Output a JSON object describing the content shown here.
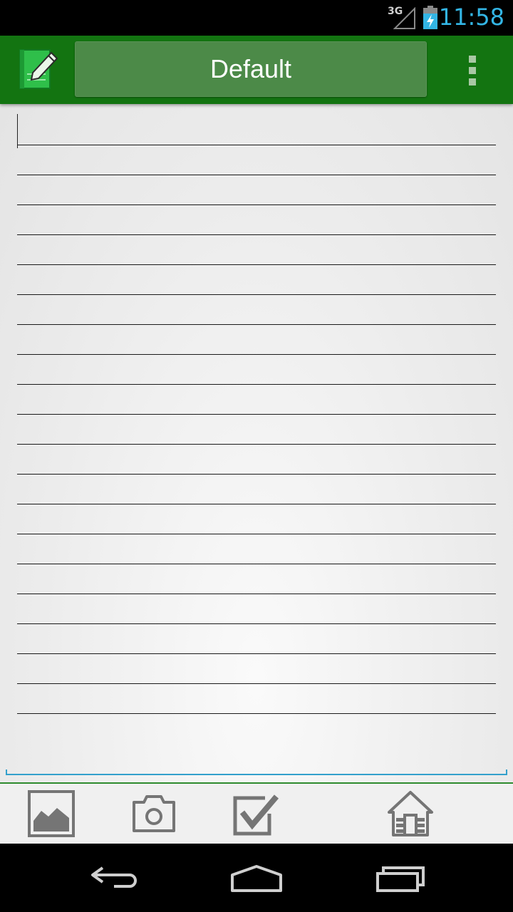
{
  "status_bar": {
    "network": "3G",
    "time": "11:58",
    "icons": [
      "signal-icon",
      "battery-charging-icon"
    ]
  },
  "action_bar": {
    "app_icon": "notepad-pencil-icon",
    "title": "Default",
    "overflow_icon": "overflow-menu-icon"
  },
  "note": {
    "text": "",
    "ruled_line_count": 20
  },
  "toolbar": {
    "items": [
      {
        "name": "insert-image",
        "icon": "image-icon"
      },
      {
        "name": "camera",
        "icon": "camera-icon"
      },
      {
        "name": "checklist",
        "icon": "checkbox-icon"
      },
      {
        "name": "home",
        "icon": "home-icon"
      }
    ]
  },
  "navigation": {
    "buttons": [
      "back-icon",
      "home-icon",
      "recent-apps-icon"
    ]
  },
  "colors": {
    "action_bar": "#137411",
    "title_button": "#4c8a48",
    "clock": "#33b5e5",
    "edit_underline": "#33a0cc",
    "toolbar_icon": "#757575"
  }
}
